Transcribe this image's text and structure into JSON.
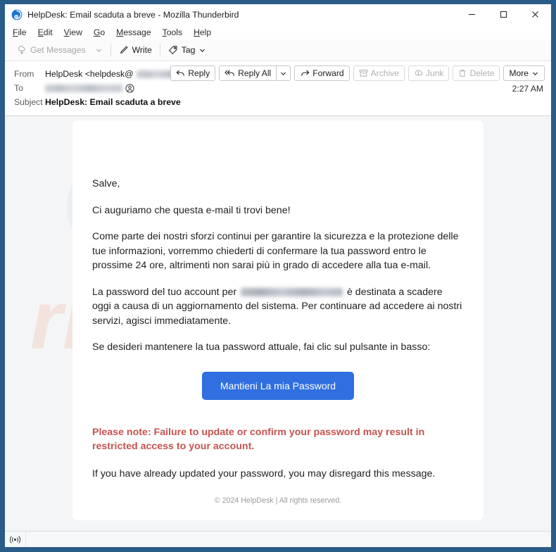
{
  "window": {
    "title": "HelpDesk: Email scaduta a breve - Mozilla Thunderbird",
    "app_icon": "thunderbird-icon",
    "minimize_label": "–",
    "maximize_label": "□",
    "close_label": "✕"
  },
  "menubar": {
    "items": [
      {
        "accesskey": "F",
        "rest": "ile"
      },
      {
        "accesskey": "E",
        "rest": "dit"
      },
      {
        "accesskey": "V",
        "rest": "iew"
      },
      {
        "accesskey": "G",
        "rest": "o"
      },
      {
        "accesskey": "M",
        "rest": "essage"
      },
      {
        "accesskey": "T",
        "rest": "ools"
      },
      {
        "accesskey": "H",
        "rest": "elp"
      }
    ]
  },
  "toolbar": {
    "get_messages": "Get Messages",
    "write": "Write",
    "tag": "Tag"
  },
  "message_header": {
    "from_label": "From",
    "from_name": "HelpDesk <helpdesk@",
    "from_close": ">",
    "to_label": "To",
    "subject_label": "Subject",
    "subject_value": "HelpDesk: Email scaduta a breve",
    "timestamp": "2:27 AM",
    "actions": {
      "reply": "Reply",
      "reply_all": "Reply All",
      "forward": "Forward",
      "archive": "Archive",
      "junk": "Junk",
      "delete": "Delete",
      "more": "More"
    }
  },
  "email_body": {
    "greeting": "Salve,",
    "paragraph_1": "Ci auguriamo che questa e-mail ti trovi bene!",
    "paragraph_2": "Come parte dei nostri sforzi continui per garantire la sicurezza e la protezione delle tue informazioni, vorremmo chiederti di confermare la tua password entro le prossime 24 ore, altrimenti non sarai più in grado di accedere alla tua e-mail.",
    "paragraph_3_before": "La password del tuo account per",
    "paragraph_3_after": "è destinata a scadere oggi a causa di un aggiornamento del sistema. Per continuare ad accedere ai nostri servizi, agisci immediatamente.",
    "paragraph_4": "Se desideri mantenere la tua password attuale, fai clic sul pulsante in basso:",
    "cta_button": "Mantieni La mia Password",
    "warning": "Please note: Failure to update or confirm your password may result in restricted access to your account.",
    "closing": "If you have already updated your password, you may disregard this message.",
    "footer": "© 2024 HelpDesk | All rights reserved."
  },
  "watermark": {
    "text": "risk.com",
    "color": "#f2e3dc"
  },
  "statusbar": {
    "icon": "broadcast-icon"
  },
  "colors": {
    "window_frame": "#2a5c8a",
    "cta_blue": "#2f6fe0",
    "warning_red": "#c5524f",
    "pane_background": "#f4f5f6"
  }
}
